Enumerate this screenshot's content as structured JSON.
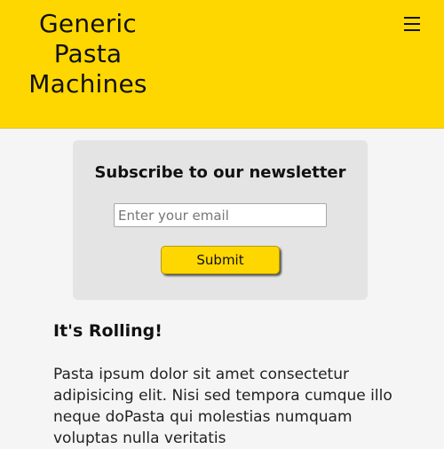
{
  "header": {
    "brand": {
      "line1": "Generic",
      "line2": "Pasta",
      "line3": "Machines"
    },
    "menu_icon": "hamburger-icon",
    "background_color": "#ffd700"
  },
  "newsletter": {
    "title": "Subscribe to our newsletter",
    "email_placeholder": "Enter your email",
    "email_value": "",
    "submit_label": "Submit"
  },
  "article": {
    "title": "It's Rolling!",
    "body": "Pasta ipsum dolor sit amet consectetur adipisicing elit. Nisi sed tempora cumque illo neque doPasta qui molestias numquam voluptas nulla veritatis"
  },
  "colors": {
    "accent": "#ffd700",
    "page_background": "#f5f5f5",
    "card_background": "#e4e4e4",
    "text": "#111111"
  }
}
